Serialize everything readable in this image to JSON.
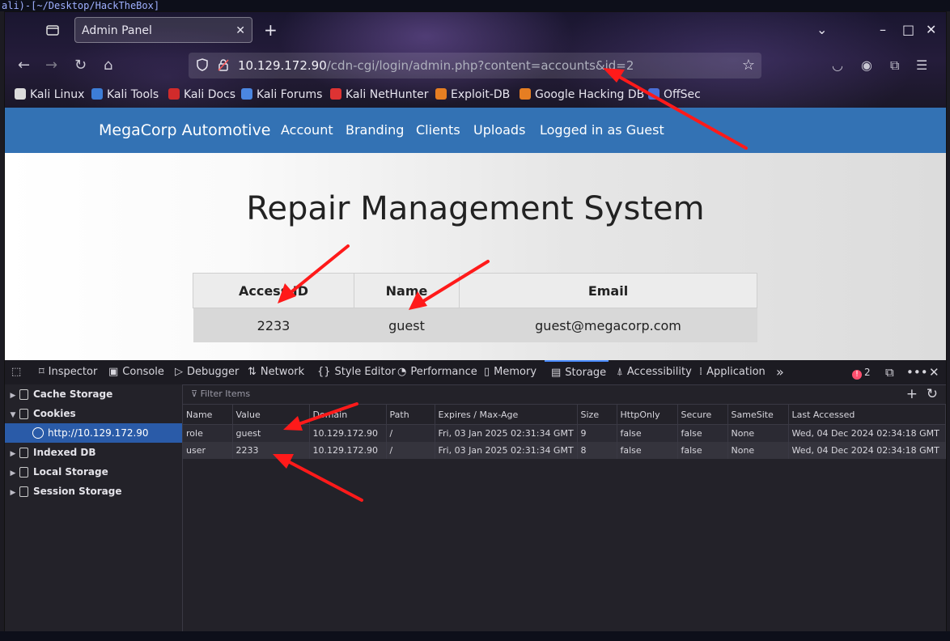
{
  "terminal": {
    "path_text": "ali)-[~/Desktop/HackTheBox]"
  },
  "browser": {
    "tab_title": "Admin Panel",
    "url_host": "10.129.172.90",
    "url_path": "/cdn-cgi/login/admin.php?content=accounts&id=2",
    "bookmarks": [
      "Kali Linux",
      "Kali Tools",
      "Kali Docs",
      "Kali Forums",
      "Kali NetHunter",
      "Exploit-DB",
      "Google Hacking DB",
      "OffSec"
    ]
  },
  "site": {
    "brand": "MegaCorp Automotive",
    "nav": [
      "Account",
      "Branding",
      "Clients",
      "Uploads",
      "Logged in as Guest"
    ],
    "title": "Repair Management System",
    "table": {
      "headers": [
        "Access ID",
        "Name",
        "Email"
      ],
      "row": [
        "2233",
        "guest",
        "guest@megacorp.com"
      ]
    }
  },
  "devtools": {
    "tabs": [
      "Inspector",
      "Console",
      "Debugger",
      "Network",
      "Style Editor",
      "Performance",
      "Memory",
      "Storage",
      "Accessibility",
      "Application"
    ],
    "active_tab": "Storage",
    "error_count": "2",
    "tree": {
      "cache_storage": "Cache Storage",
      "cookies": "Cookies",
      "cookie_origin": "http://10.129.172.90",
      "indexed_db": "Indexed DB",
      "local_storage": "Local Storage",
      "session_storage": "Session Storage"
    },
    "filter_placeholder": "Filter Items",
    "columns": [
      "Name",
      "Value",
      "Domain",
      "Path",
      "Expires / Max-Age",
      "Size",
      "HttpOnly",
      "Secure",
      "SameSite",
      "Last Accessed"
    ],
    "cookies": [
      [
        "role",
        "guest",
        "10.129.172.90",
        "/",
        "Fri, 03 Jan 2025 02:31:34 GMT",
        "9",
        "false",
        "false",
        "None",
        "Wed, 04 Dec 2024 02:34:18 GMT"
      ],
      [
        "user",
        "2233",
        "10.129.172.90",
        "/",
        "Fri, 03 Jan 2025 02:31:34 GMT",
        "8",
        "false",
        "false",
        "None",
        "Wed, 04 Dec 2024 02:34:18 GMT"
      ]
    ]
  },
  "colors": {
    "site_nav": "#3372b4",
    "selected": "#2a5ba8",
    "annotation_arrow": "#ff1a1a"
  }
}
